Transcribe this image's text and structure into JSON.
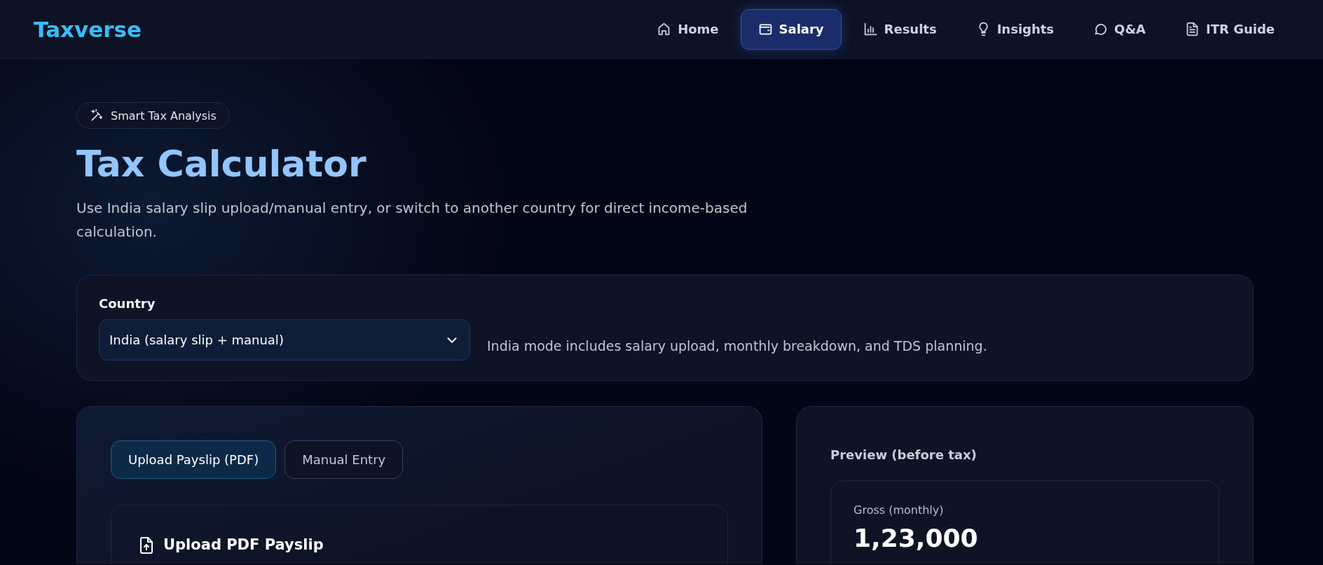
{
  "brand": "Taxverse",
  "nav": [
    {
      "label": "Home",
      "selected": false
    },
    {
      "label": "Salary",
      "selected": true
    },
    {
      "label": "Results",
      "selected": false
    },
    {
      "label": "Insights",
      "selected": false
    },
    {
      "label": "Q&A",
      "selected": false
    },
    {
      "label": "ITR Guide",
      "selected": false
    }
  ],
  "badge": "Smart Tax Analysis",
  "title": "Tax Calculator",
  "subtitle": "Use India salary slip upload/manual entry, or switch to another country for direct income-based calculation.",
  "country": {
    "label": "Country",
    "value": "India (salary slip + manual)",
    "hint": "India mode includes salary upload, monthly breakdown, and TDS planning."
  },
  "mode_tabs": [
    {
      "label": "Upload Payslip (PDF)",
      "selected": true
    },
    {
      "label": "Manual Entry",
      "selected": false
    }
  ],
  "upload": {
    "title": "Upload PDF Payslip"
  },
  "preview": {
    "title": "Preview (before tax)",
    "gross_label": "Gross (monthly)",
    "gross_value": "1,23,000"
  }
}
